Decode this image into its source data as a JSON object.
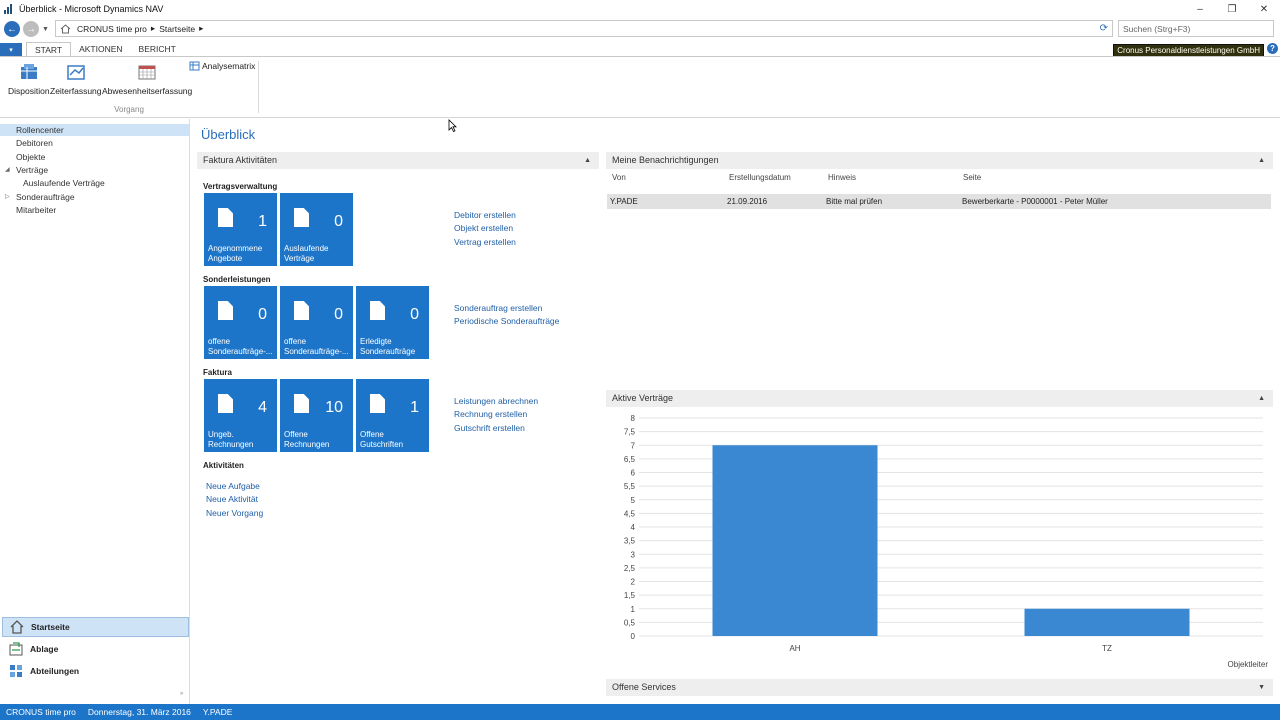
{
  "window": {
    "title": "Überblick - Microsoft Dynamics NAV",
    "minimize_label": "–",
    "maximize_label": "❐",
    "close_label": "✕"
  },
  "address": {
    "crumbs": [
      "CRONUS time pro",
      "Startseite"
    ],
    "separator": "▸",
    "search_placeholder": "Suchen (Strg+F3)"
  },
  "ribbon": {
    "menu_label": "▾",
    "tabs": [
      "START",
      "AKTIONEN",
      "BERICHT"
    ],
    "buttons": [
      "Disposition",
      "Zeiterfassung",
      "Abwesenheitserfassung"
    ],
    "analyse_label": "Analysematrix",
    "group_label": "Vorgang",
    "company": "Cronus Personaldienstleistungen GmbH",
    "help_label": "?"
  },
  "nav": {
    "items": [
      {
        "label": "Rollencenter"
      },
      {
        "label": "Debitoren"
      },
      {
        "label": "Objekte"
      },
      {
        "label": "Verträge"
      },
      {
        "label": "Auslaufende Verträge"
      },
      {
        "label": "Sonderaufträge"
      },
      {
        "label": "Mitarbeiter"
      }
    ],
    "bottom": [
      {
        "label": "Startseite"
      },
      {
        "label": "Ablage"
      },
      {
        "label": "Abteilungen"
      }
    ]
  },
  "main": {
    "title": "Überblick",
    "faktura_panel": "Faktura Aktivitäten",
    "sections": [
      "Vertragsverwaltung",
      "Sonderleistungen",
      "Faktura",
      "Aktivitäten"
    ],
    "tiles": [
      {
        "count": "1",
        "line1": "Angenommene",
        "line2": "Angebote"
      },
      {
        "count": "0",
        "line1": "Auslaufende",
        "line2": "Verträge"
      },
      {
        "count": "0",
        "line1": "offene",
        "line2": "Sonderaufträge-..."
      },
      {
        "count": "0",
        "line1": "offene",
        "line2": "Sonderaufträge-..."
      },
      {
        "count": "0",
        "line1": "Erledigte",
        "line2": "Sonderaufträge"
      },
      {
        "count": "4",
        "line1": "Ungeb.",
        "line2": "Rechnungen"
      },
      {
        "count": "10",
        "line1": "Offene",
        "line2": "Rechnungen"
      },
      {
        "count": "1",
        "line1": "Offene",
        "line2": "Gutschriften"
      }
    ],
    "links": {
      "vertrag": [
        "Debitor erstellen",
        "Objekt erstellen",
        "Vertrag erstellen"
      ],
      "sonder": [
        "Sonderauftrag erstellen",
        "Periodische Sonderaufträge"
      ],
      "faktura": [
        "Leistungen abrechnen",
        "Rechnung erstellen",
        "Gutschrift erstellen"
      ],
      "aktivitaeten": [
        "Neue Aufgabe",
        "Neue Aktivität",
        "Neuer Vorgang"
      ]
    },
    "notifications": {
      "title": "Meine Benachrichtigungen",
      "columns": [
        "Von",
        "Erstellungsdatum",
        "Hinweis",
        "Seite"
      ],
      "row": [
        "Y.PADE",
        "21.09.2016",
        "Bitte mal prüfen",
        "Bewerberkarte - P0000001 - Peter Müller"
      ]
    },
    "contracts_panel": "Aktive Verträge",
    "services_panel": "Offene Services",
    "collapse_icon": "▲",
    "expand_icon": "▼"
  },
  "chart_data": {
    "type": "bar",
    "categories": [
      "AH",
      "TZ"
    ],
    "values": [
      7,
      1
    ],
    "xlabel": "Objektleiter",
    "ylim": [
      0,
      8
    ],
    "yticks": [
      "0",
      "0,5",
      "1",
      "1,5",
      "2",
      "2,5",
      "3",
      "3,5",
      "4",
      "4,5",
      "5",
      "5,5",
      "6",
      "6,5",
      "7",
      "7,5",
      "8"
    ],
    "grid": true,
    "bar_color": "#3a87d2"
  },
  "status": {
    "company": "CRONUS time pro",
    "date": "Donnerstag, 31. März 2016",
    "user": "Y.PADE"
  }
}
